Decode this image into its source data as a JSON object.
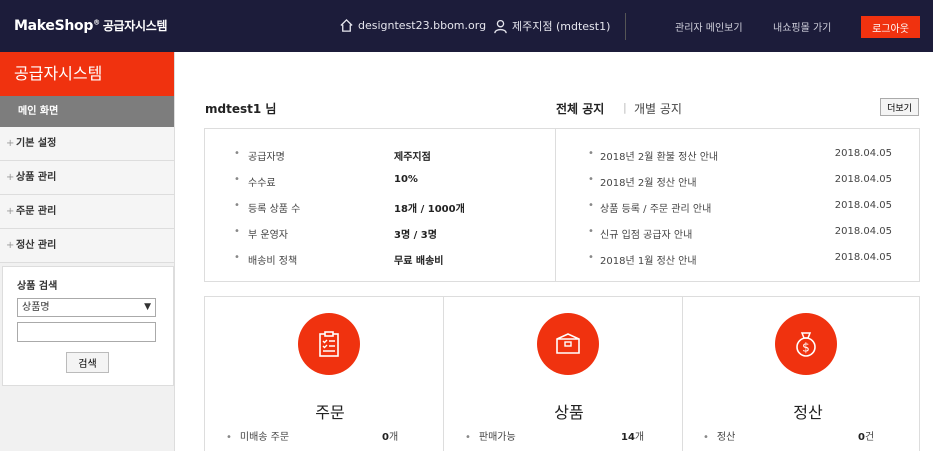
{
  "header": {
    "logo": "MakeShop",
    "logo_mark": "®",
    "logo_sub": "공급자시스템",
    "domain": "designtest23.bbom.org",
    "user": "제주지점 (mdtest1)",
    "admin_link": "관리자 메인보기",
    "mall_link": "내쇼핑몰 가기",
    "logout": "로그아웃"
  },
  "sidebar": {
    "title": "공급자시스템",
    "main": "메인 화면",
    "items": [
      {
        "label": "기본 설정"
      },
      {
        "label": "상품 관리"
      },
      {
        "label": "주문 관리"
      },
      {
        "label": "정산 관리"
      }
    ],
    "search": {
      "label": "상품 검색",
      "select_value": "상품명",
      "input_value": "",
      "button": "검색"
    }
  },
  "main": {
    "greeting": "mdtest1 님",
    "tabs": {
      "all": "전체 공지",
      "individual": "개별 공지"
    },
    "more": "더보기",
    "info": [
      {
        "label": "공급자명",
        "value": "제주지점"
      },
      {
        "label": "수수료",
        "value": "10%"
      },
      {
        "label": "등록 상품 수",
        "value": "18개 / 1000개"
      },
      {
        "label": "부 운영자",
        "value": "3명 / 3명"
      },
      {
        "label": "배송비 정책",
        "value": "무료 배송비"
      }
    ],
    "notices": [
      {
        "title": "2018년 2월 환불 정산 안내",
        "date": "2018.04.05"
      },
      {
        "title": "2018년 2월 정산 안내",
        "date": "2018.04.05"
      },
      {
        "title": "상품 등록 / 주문 관리 안내",
        "date": "2018.04.05"
      },
      {
        "title": "신규 입점 공급자 안내",
        "date": "2018.04.05"
      },
      {
        "title": "2018년 1월 정산 안내",
        "date": "2018.04.05"
      }
    ],
    "cards": [
      {
        "icon": "clipboard-icon",
        "title": "주문",
        "row_label": "미배송 주문",
        "count": "0",
        "unit": "개"
      },
      {
        "icon": "box-icon",
        "title": "상품",
        "row_label": "판매가능",
        "count": "14",
        "unit": "개"
      },
      {
        "icon": "money-bag-icon",
        "title": "정산",
        "row_label": "정산",
        "count": "0",
        "unit": "건"
      }
    ]
  },
  "colors": {
    "accent": "#f0320f",
    "header_bg": "#1c1c3a"
  }
}
